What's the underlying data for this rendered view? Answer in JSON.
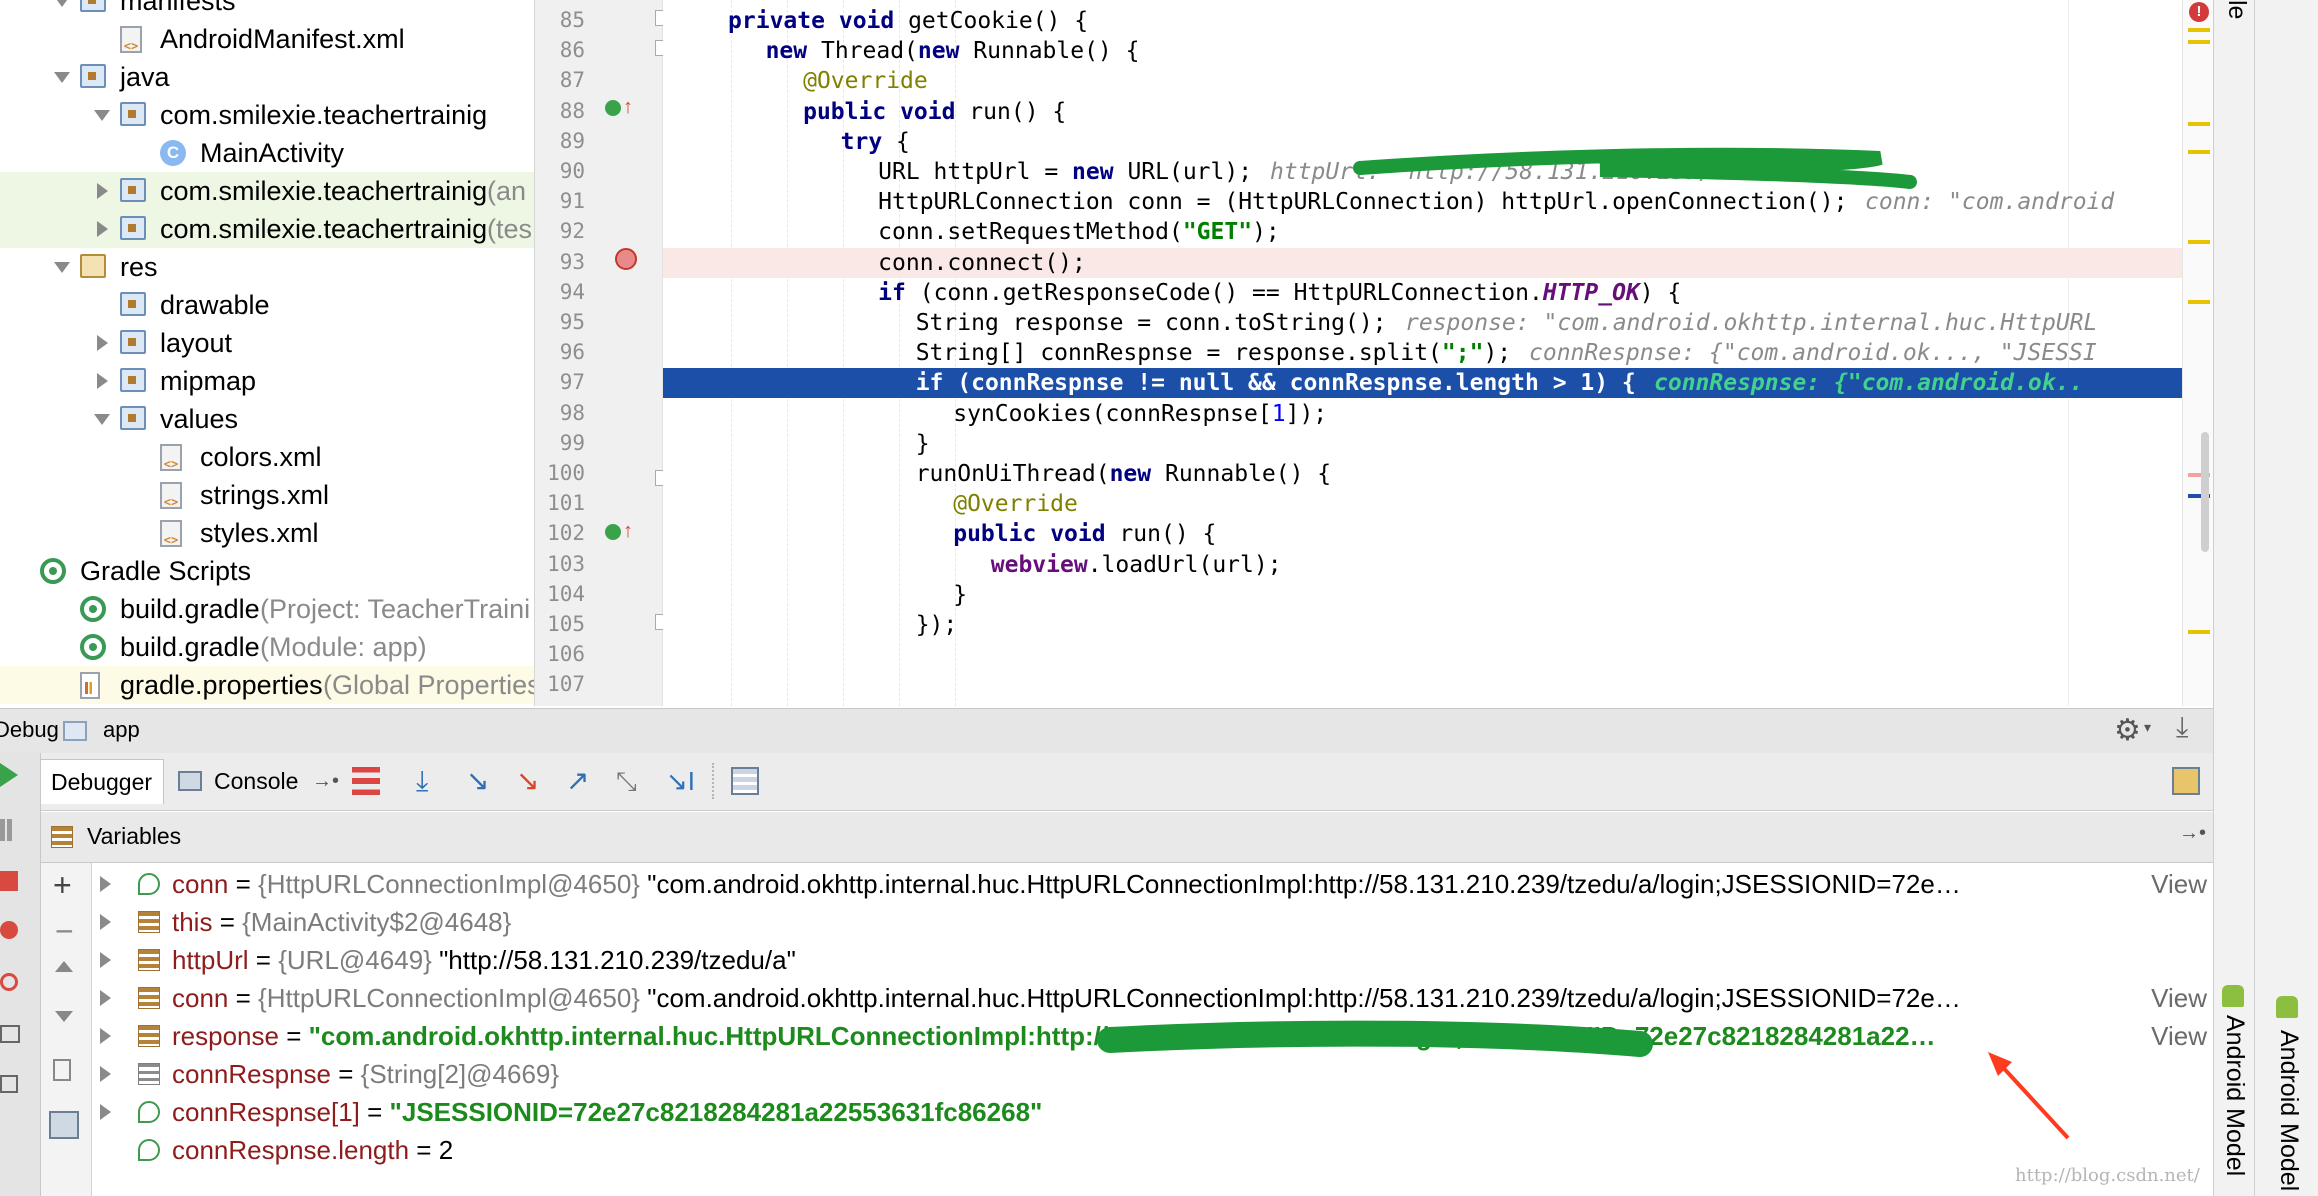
{
  "project_tree": {
    "items": [
      {
        "label": "manifests",
        "suffix": "",
        "icon": "folder-icon",
        "arrow": "down"
      },
      {
        "label": "AndroidManifest.xml",
        "suffix": "",
        "icon": "xml-file-icon",
        "arrow": ""
      },
      {
        "label": "java",
        "suffix": "",
        "icon": "folder-icon",
        "arrow": "down"
      },
      {
        "label": "com.smilexie.teachertrainig",
        "suffix": "",
        "icon": "package-icon",
        "arrow": "down"
      },
      {
        "label": "MainActivity",
        "suffix": "",
        "icon": "class-icon",
        "arrow": ""
      },
      {
        "label": "com.smilexie.teachertrainig",
        "suffix": " (an",
        "icon": "package-icon",
        "arrow": "right"
      },
      {
        "label": "com.smilexie.teachertrainig",
        "suffix": " (tes",
        "icon": "package-icon",
        "arrow": "right"
      },
      {
        "label": "res",
        "suffix": "",
        "icon": "res-folder-icon",
        "arrow": "down"
      },
      {
        "label": "drawable",
        "suffix": "",
        "icon": "folder-icon",
        "arrow": ""
      },
      {
        "label": "layout",
        "suffix": "",
        "icon": "folder-icon",
        "arrow": "right"
      },
      {
        "label": "mipmap",
        "suffix": "",
        "icon": "folder-icon",
        "arrow": "right"
      },
      {
        "label": "values",
        "suffix": "",
        "icon": "folder-icon",
        "arrow": "down"
      },
      {
        "label": "colors.xml",
        "suffix": "",
        "icon": "xml-file-icon",
        "arrow": ""
      },
      {
        "label": "strings.xml",
        "suffix": "",
        "icon": "xml-file-icon",
        "arrow": ""
      },
      {
        "label": "styles.xml",
        "suffix": "",
        "icon": "xml-file-icon",
        "arrow": ""
      },
      {
        "label": "Gradle Scripts",
        "suffix": "",
        "icon": "gradle-icon",
        "arrow": ""
      },
      {
        "label": "build.gradle",
        "suffix": " (Project: TeacherTraini",
        "icon": "gradle-icon",
        "arrow": ""
      },
      {
        "label": "build.gradle",
        "suffix": " (Module: app)",
        "icon": "gradle-icon",
        "arrow": ""
      },
      {
        "label": "gradle.properties",
        "suffix": " (Global Properties",
        "icon": "properties-icon",
        "arrow": ""
      }
    ]
  },
  "editor": {
    "line_numbers": [
      "85",
      "86",
      "87",
      "88",
      "89",
      "90",
      "91",
      "92",
      "93",
      "94",
      "95",
      "96",
      "97",
      "98",
      "99",
      "100",
      "101",
      "102",
      "103",
      "104",
      "105",
      "106",
      "107"
    ],
    "lines": [
      {
        "code": "private void getCookie() {",
        "hint": ""
      },
      {
        "code": "new Thread(new Runnable() {",
        "hint": ""
      },
      {
        "code": "@Override",
        "hint": ""
      },
      {
        "code": "public void run() {",
        "hint": ""
      },
      {
        "code": "try {",
        "hint": ""
      },
      {
        "code": "URL httpUrl = new URL(url);",
        "hint": "httpUrl: \"http://58.131.210.239/tzedu/a\""
      },
      {
        "code": "HttpURLConnection conn = (HttpURLConnection) httpUrl.openConnection();",
        "hint": "conn: \"com.android"
      },
      {
        "code": "conn.setRequestMethod(\"GET\");",
        "hint": ""
      },
      {
        "code": "conn.connect();",
        "hint": ""
      },
      {
        "code": "if (conn.getResponseCode() == HttpURLConnection.HTTP_OK) {",
        "hint": ""
      },
      {
        "code": "String response = conn.toString();",
        "hint": "response: \"com.android.okhttp.internal.huc.HttpURL"
      },
      {
        "code": "String[] connRespnse = response.split(\";\");",
        "hint": "connRespnse: {\"com.android.ok..., \"JSESSI"
      },
      {
        "code": "if (connRespnse != null && connRespnse.length > 1) {",
        "hint": "connRespnse: {\"com.android.ok.."
      },
      {
        "code": "synCookies(connRespnse[1]);",
        "hint": ""
      },
      {
        "code": "}",
        "hint": ""
      },
      {
        "code": "runOnUiThread(new Runnable() {",
        "hint": ""
      },
      {
        "code": "@Override",
        "hint": ""
      },
      {
        "code": "public void run() {",
        "hint": ""
      },
      {
        "code": "webview.loadUrl(url);",
        "hint": ""
      },
      {
        "code": "}",
        "hint": ""
      },
      {
        "code": "});",
        "hint": ""
      },
      {
        "code": "",
        "hint": ""
      },
      {
        "code": "",
        "hint": ""
      }
    ]
  },
  "debug": {
    "title": "Debug",
    "config": "app",
    "tabs": {
      "debugger": "Debugger",
      "console": "Console"
    },
    "variables_title": "Variables"
  },
  "variables": [
    {
      "name": "conn",
      "eq": " = ",
      "type": "{HttpURLConnectionImpl@4650} ",
      "value": "\"com.android.okhttp.internal.huc.HttpURLConnectionImpl:http://58.131.210.239/tzedu/a/login;JSESSIONID=72e…",
      "link": "View",
      "icon": "watch-icon",
      "strval": false,
      "expandable": true
    },
    {
      "name": "this",
      "eq": " = ",
      "type": "{MainActivity$2@4648}",
      "value": "",
      "link": "",
      "icon": "field-icon",
      "strval": false,
      "expandable": true
    },
    {
      "name": "httpUrl",
      "eq": " = ",
      "type": "{URL@4649} ",
      "value": "\"http://58.131.210.239/tzedu/a\"",
      "link": "",
      "icon": "field-icon",
      "strval": false,
      "expandable": true
    },
    {
      "name": "conn",
      "eq": " = ",
      "type": "{HttpURLConnectionImpl@4650} ",
      "value": "\"com.android.okhttp.internal.huc.HttpURLConnectionImpl:http://58.131.210.239/tzedu/a/login;JSESSIONID=72e…",
      "link": "View",
      "icon": "field-icon",
      "strval": false,
      "expandable": true
    },
    {
      "name": "response",
      "eq": " = ",
      "type": "",
      "value": "\"com.android.okhttp.internal.huc.HttpURLConnectionImpl:http://58.131.210.239/tzedu/a/login;JSESSIONID=72e27c8218284281a22…",
      "link": "View",
      "icon": "field-icon",
      "strval": true,
      "expandable": true
    },
    {
      "name": "connRespnse",
      "eq": " = ",
      "type": "{String[2]@4669}",
      "value": "",
      "link": "",
      "icon": "array-icon",
      "strval": false,
      "expandable": true
    },
    {
      "name": "connRespnse[1]",
      "eq": " = ",
      "type": "",
      "value": "\"JSESSIONID=72e27c8218284281a22553631fc86268\"",
      "link": "",
      "icon": "watch-icon",
      "strval": true,
      "expandable": true
    },
    {
      "name": "connRespnse.length",
      "eq": " = ",
      "type": "",
      "value": "2",
      "link": "",
      "icon": "watch-icon",
      "strval": false,
      "expandable": false
    }
  ],
  "side_panels": {
    "top": "le",
    "android_model_left": "Android Model",
    "android_model_right": "Android Model"
  },
  "watermark": "http://blog.csdn.net/"
}
